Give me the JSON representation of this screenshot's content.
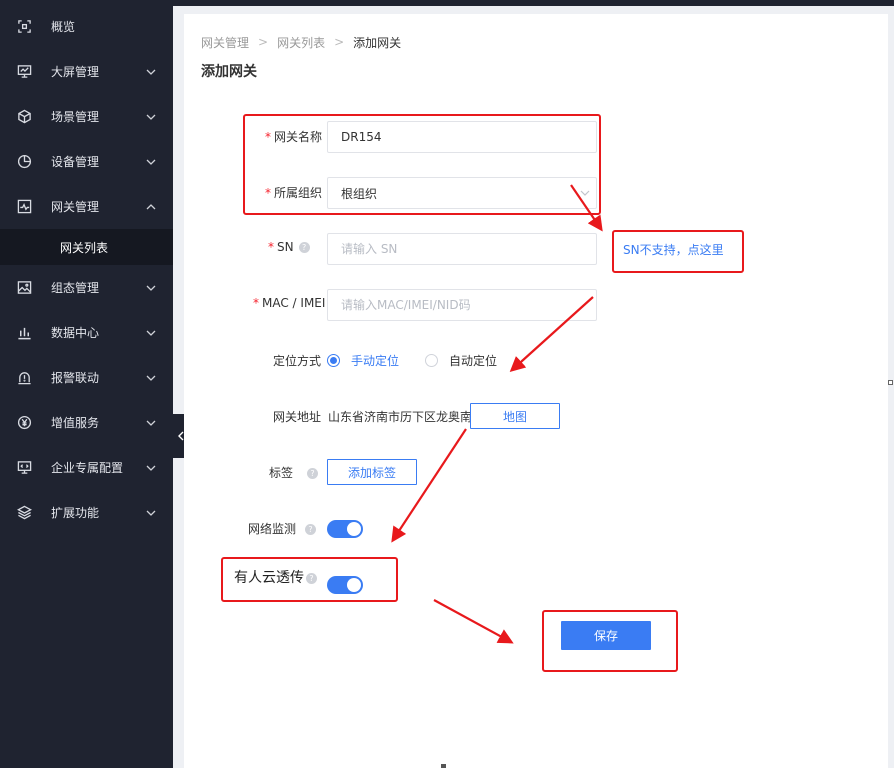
{
  "sidebar": {
    "items": [
      {
        "label": "概览",
        "icon": "overview-icon",
        "has_chevron": false
      },
      {
        "label": "大屏管理",
        "icon": "monitor-icon",
        "has_chevron": true
      },
      {
        "label": "场景管理",
        "icon": "cube-icon",
        "has_chevron": true
      },
      {
        "label": "设备管理",
        "icon": "pie-chart-icon",
        "has_chevron": true
      },
      {
        "label": "网关管理",
        "icon": "gateway-icon",
        "has_chevron": true,
        "expanded": true
      },
      {
        "label": "组态管理",
        "icon": "image-icon",
        "has_chevron": true
      },
      {
        "label": "数据中心",
        "icon": "bar-chart-icon",
        "has_chevron": true
      },
      {
        "label": "报警联动",
        "icon": "alarm-icon",
        "has_chevron": true
      },
      {
        "label": "增值服务",
        "icon": "yen-icon",
        "has_chevron": true
      },
      {
        "label": "企业专属配置",
        "icon": "code-monitor-icon",
        "has_chevron": true
      },
      {
        "label": "扩展功能",
        "icon": "layers-icon",
        "has_chevron": true
      }
    ],
    "sub_item": "网关列表"
  },
  "breadcrumb": [
    "网关管理",
    "网关列表",
    "添加网关"
  ],
  "page_title": "添加网关",
  "form": {
    "name": {
      "label": "网关名称",
      "value": "DR154"
    },
    "org": {
      "label": "所属组织",
      "value": "根组织"
    },
    "sn": {
      "label": "SN",
      "placeholder": "请输入 SN"
    },
    "mac": {
      "label": "MAC / IMEI",
      "placeholder": "请输入MAC/IMEI/NID码"
    },
    "location_mode": {
      "label": "定位方式",
      "options": [
        "手动定位",
        "自动定位"
      ],
      "selected": "手动定位"
    },
    "address": {
      "label": "网关地址",
      "value": "山东省济南市历下区龙奥南路",
      "button": "地图"
    },
    "tags": {
      "label": "标签",
      "button": "添加标签"
    },
    "network_monitor": {
      "label": "网络监测",
      "enabled": true
    },
    "usr_cloud_passthrough": {
      "label": "有人云透传",
      "enabled": true
    },
    "save_button": "保存"
  },
  "sn_link": "SN不支持，点这里",
  "colors": {
    "sidebar_bg": "#1f2330",
    "accent": "#3a7cf3",
    "annotation": "#e8191c"
  }
}
